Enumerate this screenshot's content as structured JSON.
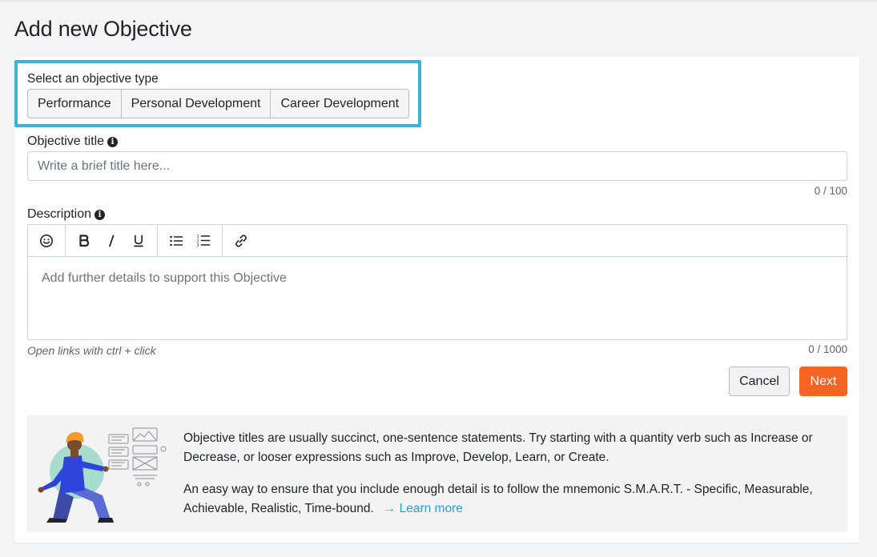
{
  "page": {
    "title": "Add new Objective"
  },
  "objective_type": {
    "label": "Select an objective type",
    "options": [
      "Performance",
      "Personal Development",
      "Career Development"
    ]
  },
  "objective_title": {
    "label": "Objective title",
    "placeholder": "Write a brief title here...",
    "counter": "0 / 100"
  },
  "description": {
    "label": "Description",
    "placeholder": "Add further details to support this Objective",
    "counter": "0 / 1000",
    "hint": "Open links with ctrl + click",
    "toolbar_icons": [
      "emoji-icon",
      "bold-icon",
      "italic-icon",
      "underline-icon",
      "bullet-list-icon",
      "numbered-list-icon",
      "link-icon"
    ]
  },
  "actions": {
    "cancel": "Cancel",
    "next": "Next"
  },
  "tips": {
    "paragraph1": "Objective titles are usually succinct, one-sentence statements. Try starting with a quantity verb such as Increase or Decrease, or looser expressions such as Improve, Develop, Learn, or Create.",
    "paragraph2": "An easy way to ensure that you include enough detail is to follow the mnemonic S.M.A.R.T. - Specific, Measurable, Achievable, Realistic, Time-bound.",
    "link": "→ Learn more"
  },
  "colors": {
    "highlight": "#3ab5d8",
    "primary": "#f46524",
    "link": "#2a9fd6"
  }
}
